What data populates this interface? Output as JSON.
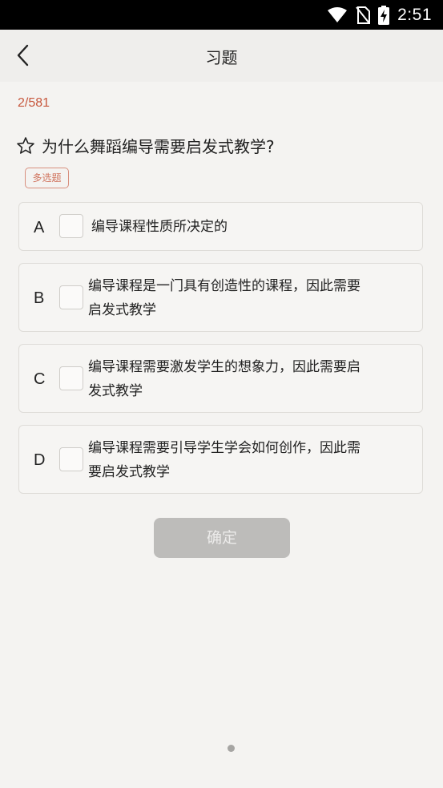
{
  "status_bar": {
    "time": "2:51",
    "icons": [
      "wifi-icon",
      "no-sim-icon",
      "battery-charging-icon"
    ]
  },
  "header": {
    "back_icon": "chevron-left-icon",
    "title": "习题"
  },
  "progress_text": "2/581",
  "question": {
    "star_icon": "star-outline-icon",
    "text": "为什么舞蹈编导需要启发式教学?",
    "type_badge": "多选题"
  },
  "options": [
    {
      "letter": "A",
      "line1": "编导课程性质所决定的",
      "line2": ""
    },
    {
      "letter": "B",
      "line1": "编导课程是一门具有创造性的课程，因此需要",
      "line2": "启发式教学"
    },
    {
      "letter": "C",
      "line1": "编导课程需要激发学生的想象力，因此需要启",
      "line2": "发式教学"
    },
    {
      "letter": "D",
      "line1": "编导课程需要引导学生学会如何创作，因此需",
      "line2": "要启发式教学"
    }
  ],
  "confirm_label": "确定",
  "colors": {
    "accent": "#c7573d",
    "badge_border": "#d88f7e",
    "button_disabled": "#bdbcba",
    "background": "#f4f3f1"
  }
}
